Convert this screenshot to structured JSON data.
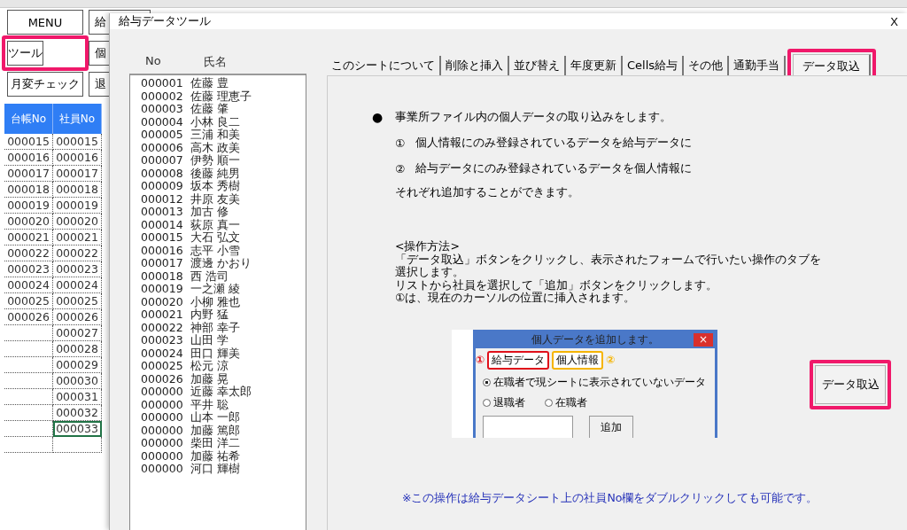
{
  "spreadsheet": {
    "buttons": [
      {
        "label": "MENU",
        "highlighted": false
      },
      {
        "label": "給",
        "highlighted": false
      },
      {
        "label": "ツール",
        "highlighted": true
      },
      {
        "label": "個",
        "highlighted": false
      },
      {
        "label": "月変チェック",
        "highlighted": false
      },
      {
        "label": "退",
        "highlighted": false
      }
    ],
    "columns": [
      "台帳No",
      "社員No"
    ],
    "rows": [
      {
        "cells": [
          "000015",
          "000015"
        ],
        "selected": false
      },
      {
        "cells": [
          "000016",
          "000016"
        ],
        "selected": false
      },
      {
        "cells": [
          "000017",
          "000017"
        ],
        "selected": false
      },
      {
        "cells": [
          "000018",
          "000018"
        ],
        "selected": false
      },
      {
        "cells": [
          "000019",
          "000019"
        ],
        "selected": false
      },
      {
        "cells": [
          "000020",
          "000020"
        ],
        "selected": false
      },
      {
        "cells": [
          "000021",
          "000021"
        ],
        "selected": false
      },
      {
        "cells": [
          "000022",
          "000022"
        ],
        "selected": false
      },
      {
        "cells": [
          "000023",
          "000023"
        ],
        "selected": false
      },
      {
        "cells": [
          "000024",
          "000024"
        ],
        "selected": false
      },
      {
        "cells": [
          "000025",
          "000025"
        ],
        "selected": false
      },
      {
        "cells": [
          "000026",
          "000026"
        ],
        "selected": false
      },
      {
        "cells": [
          "",
          "000027"
        ],
        "selected": false
      },
      {
        "cells": [
          "",
          "000028"
        ],
        "selected": false
      },
      {
        "cells": [
          "",
          "000029"
        ],
        "selected": false
      },
      {
        "cells": [
          "",
          "000030"
        ],
        "selected": false
      },
      {
        "cells": [
          "",
          "000031"
        ],
        "selected": false
      },
      {
        "cells": [
          "",
          "000032"
        ],
        "selected": false
      },
      {
        "cells": [
          "",
          "000033"
        ],
        "selected": true
      },
      {
        "cells": [
          "",
          ""
        ],
        "selected": false
      }
    ]
  },
  "dialog": {
    "title": "給与データツール",
    "close": "X",
    "list": {
      "columns": [
        "No",
        "氏名"
      ],
      "items": [
        {
          "no": "000001",
          "name": "佐藤 豊"
        },
        {
          "no": "000002",
          "name": "佐藤 理恵子"
        },
        {
          "no": "000003",
          "name": "佐藤 肇"
        },
        {
          "no": "000004",
          "name": "小林 良二"
        },
        {
          "no": "000005",
          "name": "三浦 和美"
        },
        {
          "no": "000006",
          "name": "高木 政美"
        },
        {
          "no": "000007",
          "name": "伊勢 順一"
        },
        {
          "no": "000008",
          "name": "後藤 純男"
        },
        {
          "no": "000009",
          "name": "坂本 秀樹"
        },
        {
          "no": "000012",
          "name": "井原 友美"
        },
        {
          "no": "000013",
          "name": "加古 修"
        },
        {
          "no": "000014",
          "name": "荻原 真一"
        },
        {
          "no": "000015",
          "name": "大石 弘文"
        },
        {
          "no": "000016",
          "name": "志平 小雪"
        },
        {
          "no": "000017",
          "name": "渡邊 かおり"
        },
        {
          "no": "000018",
          "name": "西 浩司"
        },
        {
          "no": "000019",
          "name": "一之瀬 綾"
        },
        {
          "no": "000020",
          "name": "小柳 雅也"
        },
        {
          "no": "000021",
          "name": "内野 猛"
        },
        {
          "no": "000022",
          "name": "神部 幸子"
        },
        {
          "no": "000023",
          "name": "山田 学"
        },
        {
          "no": "000024",
          "name": "田口 輝美"
        },
        {
          "no": "000025",
          "name": "松元 涼"
        },
        {
          "no": "000026",
          "name": "加藤 晃"
        },
        {
          "no": "000000",
          "name": "近藤 幸太郎"
        },
        {
          "no": "000000",
          "name": "平井 聡"
        },
        {
          "no": "000000",
          "name": "山本 一郎"
        },
        {
          "no": "000000",
          "name": "加藤 篤郎"
        },
        {
          "no": "000000",
          "name": "柴田 洋二"
        },
        {
          "no": "000000",
          "name": "加藤 祐希"
        },
        {
          "no": "000000",
          "name": "河口 輝樹"
        }
      ]
    },
    "tabs": [
      {
        "label": "このシートについて",
        "selected": false,
        "highlighted": false
      },
      {
        "label": "削除と挿入",
        "selected": false,
        "highlighted": false
      },
      {
        "label": "並び替え",
        "selected": false,
        "highlighted": false
      },
      {
        "label": "年度更新",
        "selected": false,
        "highlighted": false
      },
      {
        "label": "Cells給与",
        "selected": false,
        "highlighted": false
      },
      {
        "label": "その他",
        "selected": false,
        "highlighted": false
      },
      {
        "label": "通勤手当",
        "selected": false,
        "highlighted": false
      },
      {
        "label": "データ取込",
        "selected": true,
        "highlighted": true
      }
    ],
    "content": {
      "bullet": "●",
      "intro": "事業所ファイル内の個人データの取り込みをします。",
      "points": [
        {
          "marker": "①",
          "text": "個人情報にのみ登録されているデータを給与データに"
        },
        {
          "marker": "②",
          "text": "給与データにのみ登録されているデータを個人情報に"
        }
      ],
      "closing": "それぞれ追加することができます。",
      "method_title": "<操作方法>",
      "method_lines": [
        "「データ取込」ボタンをクリックし、表示されたフォームで行いたい操作のタブを",
        "選択します。",
        "リストから社員を選択して「追加」ボタンをクリックします。",
        "①は、現在のカーソルの位置に挿入されます。"
      ],
      "preview": {
        "title": "個人データを追加します。",
        "close": "×",
        "tabs": [
          {
            "marker": "①",
            "label": "給与データ",
            "color": "#e0101a"
          },
          {
            "marker": "②",
            "label": "個人情報",
            "color": "#f5b400"
          }
        ],
        "options": [
          {
            "label": "在職者で現シートに表示されていないデータ",
            "selected": true
          },
          {
            "label": "退職者",
            "selected": false
          },
          {
            "label": "在職者",
            "selected": false
          }
        ],
        "button": "追加"
      },
      "action_button": {
        "label": "データ取込",
        "highlighted": true
      },
      "note": "※この操作は給与データシート上の社員No欄をダブルクリックしても可能です。"
    }
  }
}
